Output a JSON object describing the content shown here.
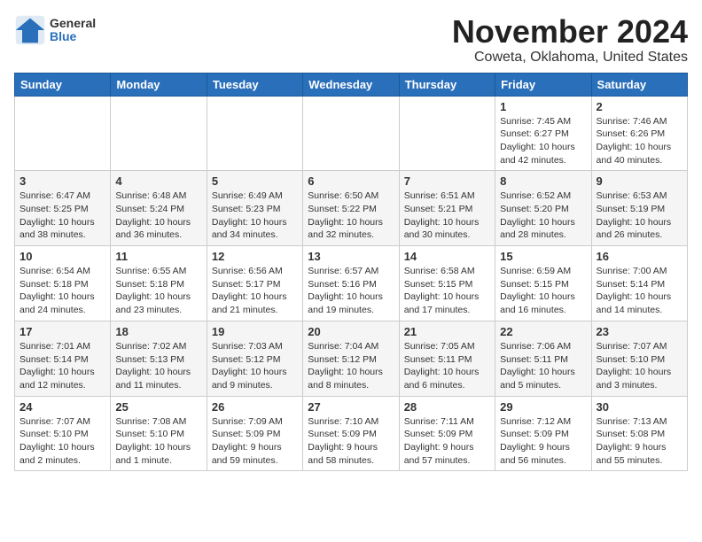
{
  "header": {
    "logo_general": "General",
    "logo_blue": "Blue",
    "month": "November 2024",
    "location": "Coweta, Oklahoma, United States"
  },
  "days_of_week": [
    "Sunday",
    "Monday",
    "Tuesday",
    "Wednesday",
    "Thursday",
    "Friday",
    "Saturday"
  ],
  "weeks": [
    {
      "days": [
        {
          "num": "",
          "info": ""
        },
        {
          "num": "",
          "info": ""
        },
        {
          "num": "",
          "info": ""
        },
        {
          "num": "",
          "info": ""
        },
        {
          "num": "",
          "info": ""
        },
        {
          "num": "1",
          "info": "Sunrise: 7:45 AM\nSunset: 6:27 PM\nDaylight: 10 hours\nand 42 minutes."
        },
        {
          "num": "2",
          "info": "Sunrise: 7:46 AM\nSunset: 6:26 PM\nDaylight: 10 hours\nand 40 minutes."
        }
      ]
    },
    {
      "days": [
        {
          "num": "3",
          "info": "Sunrise: 6:47 AM\nSunset: 5:25 PM\nDaylight: 10 hours\nand 38 minutes."
        },
        {
          "num": "4",
          "info": "Sunrise: 6:48 AM\nSunset: 5:24 PM\nDaylight: 10 hours\nand 36 minutes."
        },
        {
          "num": "5",
          "info": "Sunrise: 6:49 AM\nSunset: 5:23 PM\nDaylight: 10 hours\nand 34 minutes."
        },
        {
          "num": "6",
          "info": "Sunrise: 6:50 AM\nSunset: 5:22 PM\nDaylight: 10 hours\nand 32 minutes."
        },
        {
          "num": "7",
          "info": "Sunrise: 6:51 AM\nSunset: 5:21 PM\nDaylight: 10 hours\nand 30 minutes."
        },
        {
          "num": "8",
          "info": "Sunrise: 6:52 AM\nSunset: 5:20 PM\nDaylight: 10 hours\nand 28 minutes."
        },
        {
          "num": "9",
          "info": "Sunrise: 6:53 AM\nSunset: 5:19 PM\nDaylight: 10 hours\nand 26 minutes."
        }
      ]
    },
    {
      "days": [
        {
          "num": "10",
          "info": "Sunrise: 6:54 AM\nSunset: 5:18 PM\nDaylight: 10 hours\nand 24 minutes."
        },
        {
          "num": "11",
          "info": "Sunrise: 6:55 AM\nSunset: 5:18 PM\nDaylight: 10 hours\nand 23 minutes."
        },
        {
          "num": "12",
          "info": "Sunrise: 6:56 AM\nSunset: 5:17 PM\nDaylight: 10 hours\nand 21 minutes."
        },
        {
          "num": "13",
          "info": "Sunrise: 6:57 AM\nSunset: 5:16 PM\nDaylight: 10 hours\nand 19 minutes."
        },
        {
          "num": "14",
          "info": "Sunrise: 6:58 AM\nSunset: 5:15 PM\nDaylight: 10 hours\nand 17 minutes."
        },
        {
          "num": "15",
          "info": "Sunrise: 6:59 AM\nSunset: 5:15 PM\nDaylight: 10 hours\nand 16 minutes."
        },
        {
          "num": "16",
          "info": "Sunrise: 7:00 AM\nSunset: 5:14 PM\nDaylight: 10 hours\nand 14 minutes."
        }
      ]
    },
    {
      "days": [
        {
          "num": "17",
          "info": "Sunrise: 7:01 AM\nSunset: 5:14 PM\nDaylight: 10 hours\nand 12 minutes."
        },
        {
          "num": "18",
          "info": "Sunrise: 7:02 AM\nSunset: 5:13 PM\nDaylight: 10 hours\nand 11 minutes."
        },
        {
          "num": "19",
          "info": "Sunrise: 7:03 AM\nSunset: 5:12 PM\nDaylight: 10 hours\nand 9 minutes."
        },
        {
          "num": "20",
          "info": "Sunrise: 7:04 AM\nSunset: 5:12 PM\nDaylight: 10 hours\nand 8 minutes."
        },
        {
          "num": "21",
          "info": "Sunrise: 7:05 AM\nSunset: 5:11 PM\nDaylight: 10 hours\nand 6 minutes."
        },
        {
          "num": "22",
          "info": "Sunrise: 7:06 AM\nSunset: 5:11 PM\nDaylight: 10 hours\nand 5 minutes."
        },
        {
          "num": "23",
          "info": "Sunrise: 7:07 AM\nSunset: 5:10 PM\nDaylight: 10 hours\nand 3 minutes."
        }
      ]
    },
    {
      "days": [
        {
          "num": "24",
          "info": "Sunrise: 7:07 AM\nSunset: 5:10 PM\nDaylight: 10 hours\nand 2 minutes."
        },
        {
          "num": "25",
          "info": "Sunrise: 7:08 AM\nSunset: 5:10 PM\nDaylight: 10 hours\nand 1 minute."
        },
        {
          "num": "26",
          "info": "Sunrise: 7:09 AM\nSunset: 5:09 PM\nDaylight: 9 hours\nand 59 minutes."
        },
        {
          "num": "27",
          "info": "Sunrise: 7:10 AM\nSunset: 5:09 PM\nDaylight: 9 hours\nand 58 minutes."
        },
        {
          "num": "28",
          "info": "Sunrise: 7:11 AM\nSunset: 5:09 PM\nDaylight: 9 hours\nand 57 minutes."
        },
        {
          "num": "29",
          "info": "Sunrise: 7:12 AM\nSunset: 5:09 PM\nDaylight: 9 hours\nand 56 minutes."
        },
        {
          "num": "30",
          "info": "Sunrise: 7:13 AM\nSunset: 5:08 PM\nDaylight: 9 hours\nand 55 minutes."
        }
      ]
    }
  ]
}
